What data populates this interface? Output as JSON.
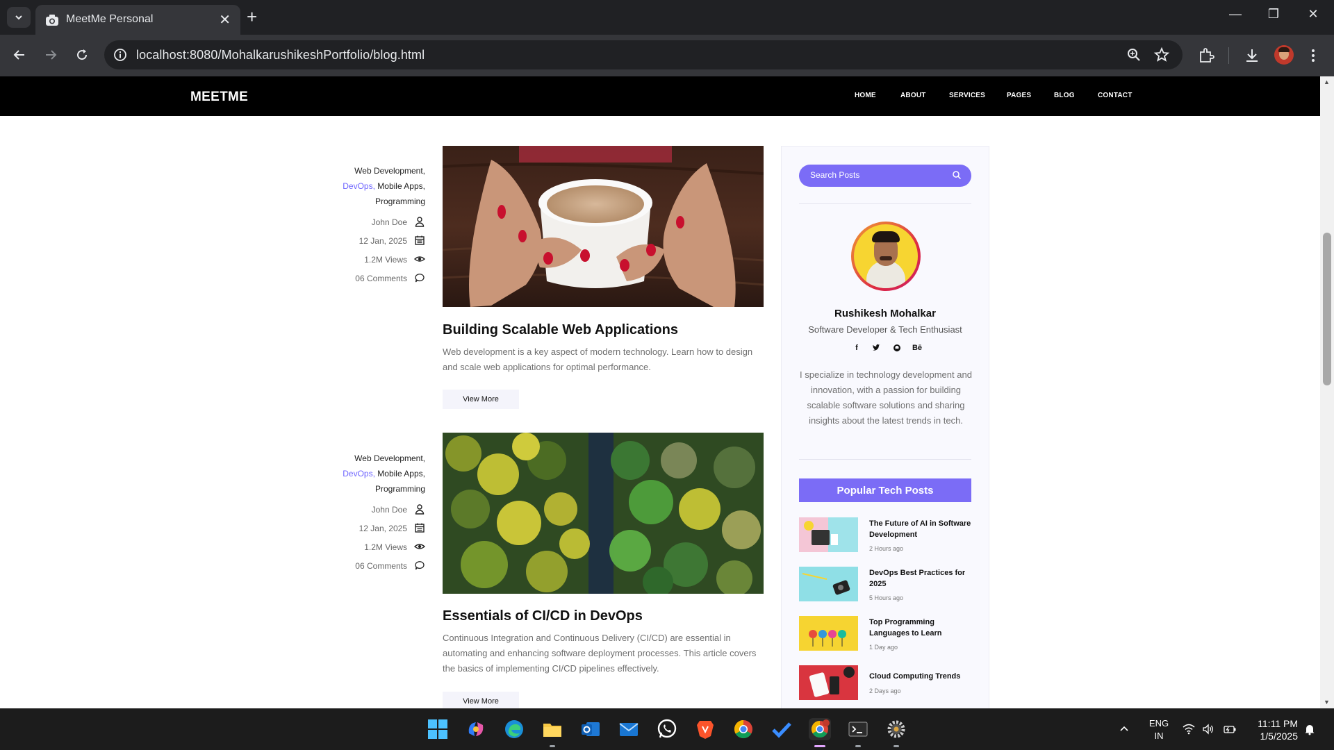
{
  "browser": {
    "tab_title": "MeetMe Personal",
    "url": "localhost:8080/MohalkarushikeshPortfolio/blog.html"
  },
  "site": {
    "brand": "MEETME",
    "menu": [
      "HOME",
      "ABOUT",
      "SERVICES",
      "PAGES",
      "BLOG",
      "CONTACT"
    ]
  },
  "posts": [
    {
      "categories": [
        "Web Development,",
        "DevOps,",
        "Mobile Apps,",
        "Programming"
      ],
      "author": "John Doe",
      "date": "12 Jan, 2025",
      "views": "1.2M Views",
      "comments": "06 Comments",
      "title": "Building Scalable Web Applications",
      "excerpt": "Web development is a key aspect of modern technology. Learn how to design and scale web applications for optimal performance.",
      "button": "View More"
    },
    {
      "categories": [
        "Web Development,",
        "DevOps,",
        "Mobile Apps,",
        "Programming"
      ],
      "author": "John Doe",
      "date": "12 Jan, 2025",
      "views": "1.2M Views",
      "comments": "06 Comments",
      "title": "Essentials of CI/CD in DevOps",
      "excerpt": "Continuous Integration and Continuous Delivery (CI/CD) are essential in automating and enhancing software deployment processes. This article covers the basics of implementing CI/CD pipelines effectively.",
      "button": "View More"
    }
  ],
  "sidebar": {
    "search_placeholder": "Search Posts",
    "profile": {
      "name": "Rushikesh Mohalkar",
      "role": "Software Developer & Tech Enthusiast",
      "social": [
        "f",
        "t",
        "gh",
        "Bē"
      ],
      "bio": "I specialize in technology development and innovation, with a passion for building scalable software solutions and sharing insights about the latest trends in tech."
    },
    "popular_title": "Popular Tech Posts",
    "popular": [
      {
        "title": "The Future of AI in Software Development",
        "time": "2 Hours ago"
      },
      {
        "title": "DevOps Best Practices for 2025",
        "time": "5 Hours ago"
      },
      {
        "title": "Top Programming Languages to Learn",
        "time": "1 Day ago"
      },
      {
        "title": "Cloud Computing Trends",
        "time": "2 Days ago"
      }
    ]
  },
  "taskbar": {
    "lang_line1": "ENG",
    "lang_line2": "IN",
    "time": "11:11 PM",
    "date": "1/5/2025"
  },
  "colors": {
    "accent": "#7b6cf6",
    "header_bg": "#000000",
    "link": "#6c63ff"
  }
}
